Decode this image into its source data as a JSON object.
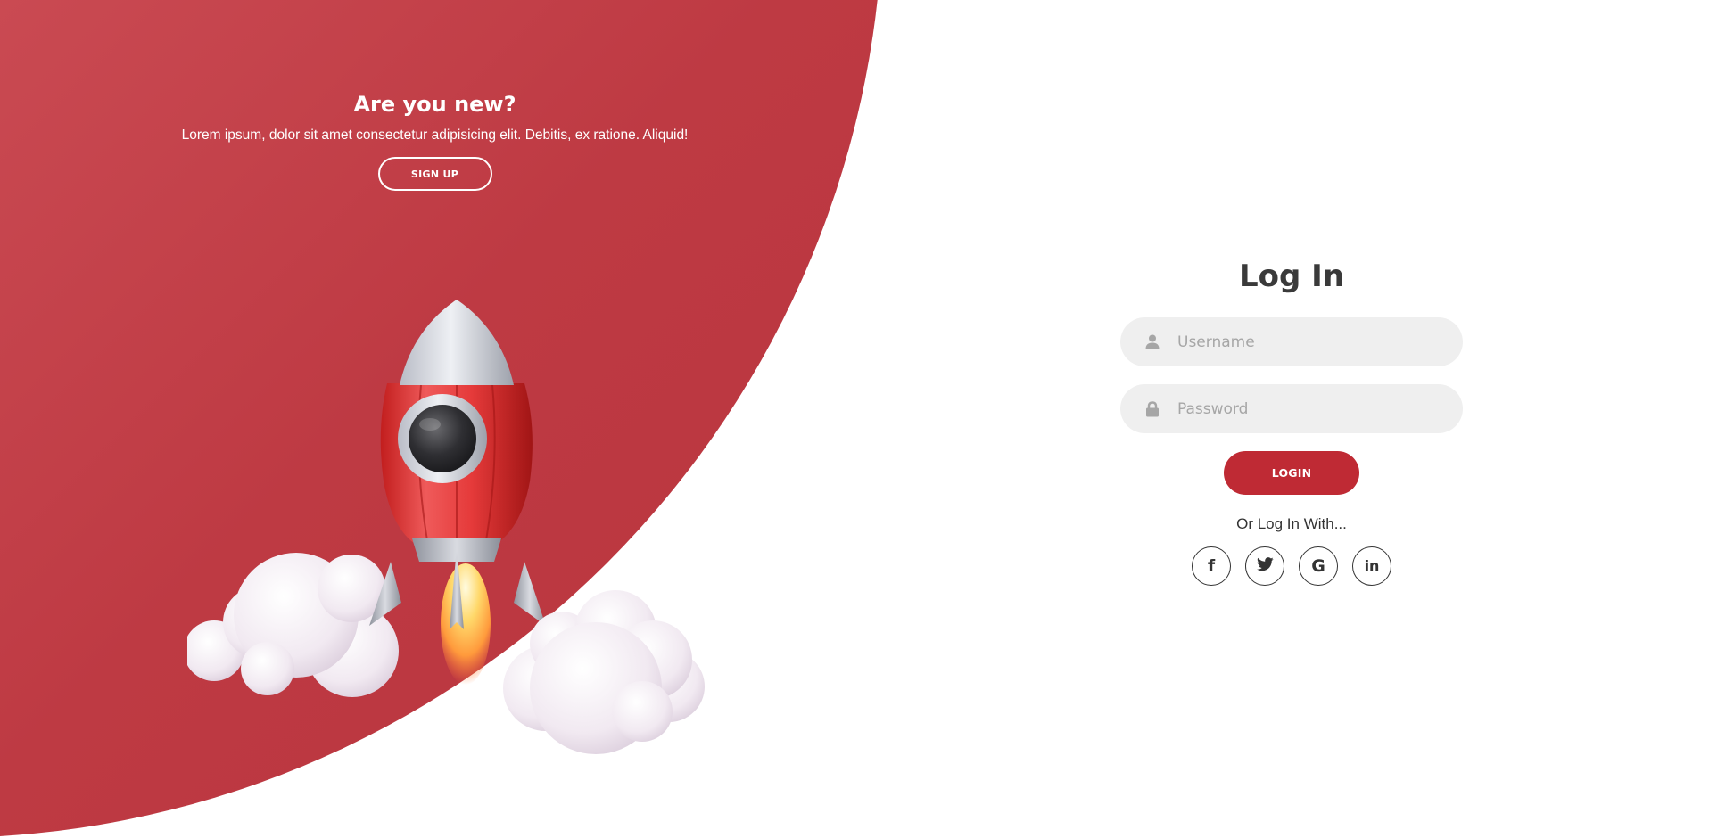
{
  "promo": {
    "title": "Are you new?",
    "text": "Lorem ipsum, dolor sit amet consectetur adipisicing elit. Debitis, ex ratione. Aliquid!",
    "signup_label": "SIGN UP"
  },
  "login": {
    "title": "Log In",
    "username_placeholder": "Username",
    "password_placeholder": "Password",
    "login_label": "LOGIN",
    "social_text": "Or Log In With...",
    "social": [
      {
        "name": "facebook",
        "glyph": "f"
      },
      {
        "name": "twitter",
        "glyph": "twitter-bird"
      },
      {
        "name": "google",
        "glyph": "G"
      },
      {
        "name": "linkedin",
        "glyph": "in"
      }
    ]
  },
  "colors": {
    "accent": "#bf2a34",
    "panel_light": "#db6c73",
    "panel_dark": "#b9343d",
    "field_bg": "#efefef"
  },
  "icons": [
    "user-icon",
    "lock-icon",
    "facebook-icon",
    "twitter-icon",
    "google-icon",
    "linkedin-icon",
    "rocket-icon",
    "cloud-icon"
  ]
}
